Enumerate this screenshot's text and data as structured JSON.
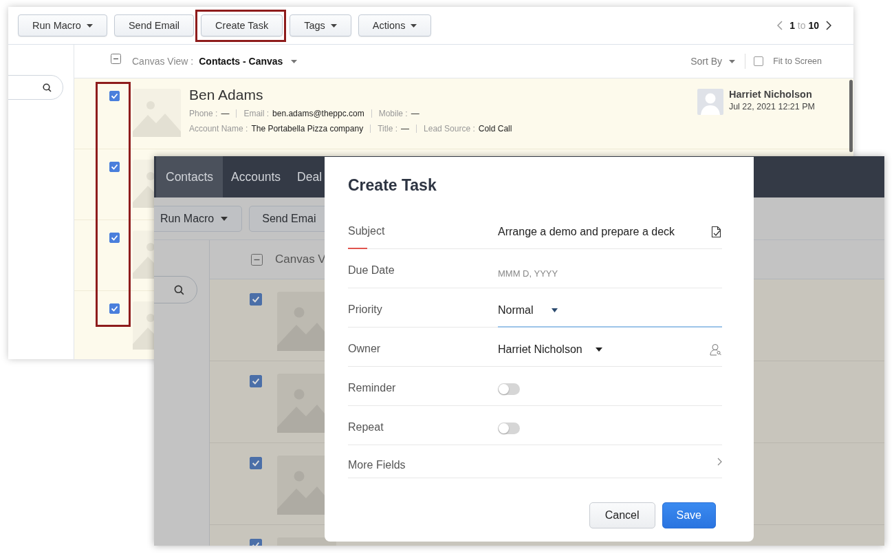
{
  "back_window": {
    "toolbar": [
      {
        "label": "Run Macro",
        "dropdown": true,
        "highlighted": false
      },
      {
        "label": "Send Email",
        "dropdown": false,
        "highlighted": false
      },
      {
        "label": "Create Task",
        "dropdown": false,
        "highlighted": true
      },
      {
        "label": "Tags",
        "dropdown": true,
        "highlighted": false
      },
      {
        "label": "Actions",
        "dropdown": true,
        "highlighted": false
      }
    ],
    "pagination": "**1** to **10**",
    "view_header": {
      "select_all_partial": true,
      "label": "Canvas View :",
      "value": "Contacts - Canvas",
      "sort": "Sort By",
      "fit_to_screen": {
        "label": "Fit to Screen",
        "checked": false
      }
    },
    "selection_highlighted": true,
    "records": [
      {
        "checked": true,
        "name": "Ben Adams",
        "lines": [
          [
            {
              "label": "Phone :",
              "value": "—"
            },
            {
              "label": "Email :",
              "value": "ben.adams@theppc.com"
            },
            {
              "label": "Mobile :",
              "value": "—"
            }
          ],
          [
            {
              "label": "Account Name :",
              "value": "The Portabella Pizza company"
            },
            {
              "label": "Title :",
              "value": "—"
            },
            {
              "label": "Lead Source :",
              "value": "Cold Call"
            }
          ]
        ],
        "owner": "Harriet Nicholson",
        "modified": "Jul 22, 2021 12:21 PM"
      },
      {
        "checked": true
      },
      {
        "checked": true
      },
      {
        "checked": true
      }
    ]
  },
  "front_window": {
    "tabs": [
      {
        "label": "Contacts",
        "selected": true
      },
      {
        "label": "Accounts",
        "selected": false
      },
      {
        "label": "Deal",
        "selected": false
      }
    ],
    "toolbar": [
      {
        "label": "Run Macro",
        "dropdown": true
      },
      {
        "label": "Send Emai",
        "dropdown": false
      }
    ],
    "select_all_partial": true,
    "view_label": "Canvas V",
    "records": [
      {
        "checked": true
      },
      {
        "checked": true
      },
      {
        "checked": true
      },
      {
        "checked": true
      }
    ],
    "dialog": {
      "title": "Create Task",
      "fields": [
        {
          "kind": "text",
          "label": "Subject",
          "value": "Arrange a demo and prepare a deck",
          "mandatory": true,
          "focused": false
        },
        {
          "kind": "date",
          "label": "Due Date",
          "placeholder": "MMM D, YYYY",
          "mandatory": false,
          "focused": false
        },
        {
          "kind": "select",
          "label": "Priority",
          "value": "Normal",
          "mandatory": false,
          "focused": true
        },
        {
          "kind": "lookup",
          "label": "Owner",
          "value": "Harriet Nicholson",
          "mandatory": false,
          "focused": false
        },
        {
          "kind": "toggle",
          "label": "Reminder",
          "on": false
        },
        {
          "kind": "toggle",
          "label": "Repeat",
          "on": false
        },
        {
          "kind": "link",
          "label": "More Fields"
        }
      ],
      "buttons": [
        {
          "label": "Cancel",
          "primary": false
        },
        {
          "label": "Save",
          "primary": true
        }
      ]
    }
  }
}
